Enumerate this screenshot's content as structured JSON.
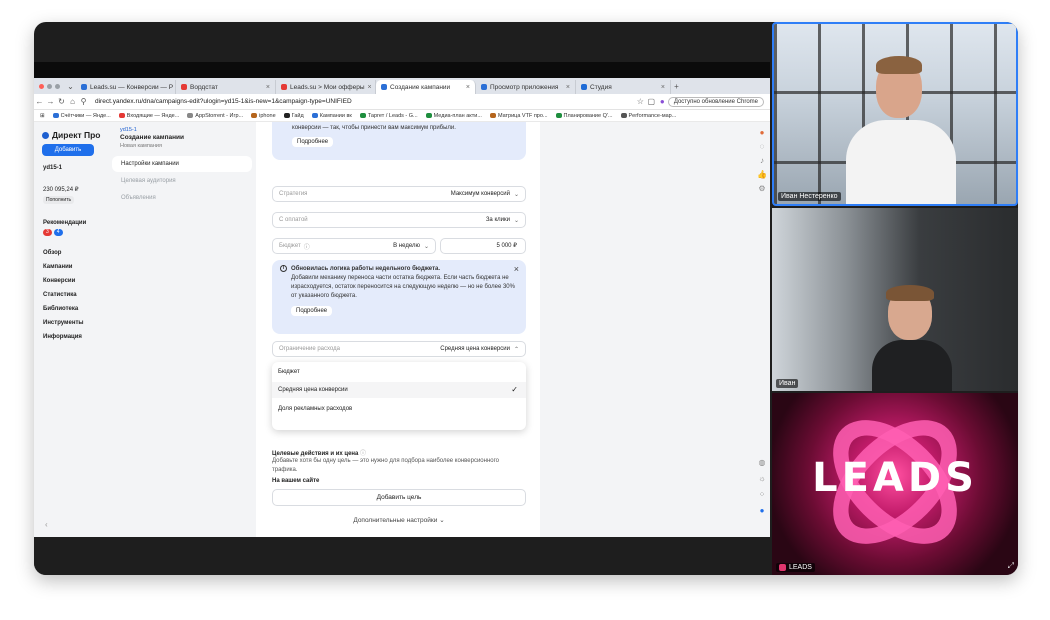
{
  "browser": {
    "tabs": [
      {
        "label": "Leads.su — Конверсии — Р",
        "color": "#2b6fd6",
        "active": false
      },
      {
        "label": "Вордстат",
        "color": "#e53935",
        "active": false
      },
      {
        "label": "Leads.su > Мои офферы",
        "color": "#e53935",
        "active": false
      },
      {
        "label": "Создание кампании",
        "color": "#2b6fd6",
        "active": true
      },
      {
        "label": "Просмотр приложения",
        "color": "#2b6fd6",
        "active": false
      },
      {
        "label": "Студия",
        "color": "#1e6bd6",
        "active": false
      }
    ],
    "url": "direct.yandex.ru/dna/campaigns-edit?ulogin=yd15-1&is-new=1&campaign-type=UNIFIED",
    "update_button": "Доступно обновление Chrome",
    "bookmarks": [
      "Счётчики — Янде...",
      "Входящие — Янде...",
      "AppStorrent - Игр...",
      "iphone",
      "Гайд",
      "Кампании вк",
      "Таргет / Leads - G...",
      "Медиа-план акти...",
      "Матрица VTF про...",
      "Планирование Q'...",
      "Performance-мар..."
    ]
  },
  "sidebar": {
    "logo": "Директ Про",
    "add_button": "Добавить",
    "account": "yd15-1",
    "balance": "230 095,24 ₽",
    "pay_button": "Пополнить",
    "recommendations": "Рекомендации",
    "badges": [
      "3",
      "4"
    ],
    "items": [
      "Обзор",
      "Кампании",
      "Конверсии",
      "Статистика",
      "Библиотека",
      "Инструменты",
      "Информация"
    ],
    "collapse": "‹"
  },
  "steps": {
    "account": "yd15-1",
    "title": "Создание кампании",
    "subtitle": "Новая кампания",
    "items": [
      {
        "label": "Настройки кампании",
        "state": "active"
      },
      {
        "label": "Целевая аудитория",
        "state": "muted"
      },
      {
        "label": "Объявления",
        "state": "muted"
      }
    ]
  },
  "form": {
    "top_info_text": "конверсии — так, чтобы принести вам максимум прибыли.",
    "more_label": "Подробнее",
    "strategy": {
      "label": "Стратегия",
      "value": "Максимум конверсий"
    },
    "payment": {
      "label": "С оплатой",
      "value": "За клики"
    },
    "budget": {
      "label": "Бюджет",
      "period": "В неделю",
      "amount": "5 000 ₽"
    },
    "notice": {
      "title": "Обновилась логика работы недельного бюджета.",
      "text": "Добавили механику переноса части остатка бюджета. Если часть бюджета не израсходуется, остаток переносится на следующую неделю — но не более 30% от указанного бюджета.",
      "button": "Подробнее"
    },
    "spend_limit": {
      "label": "Ограничение расхода",
      "value": "Средняя цена конверсии"
    },
    "dropdown_options": [
      "Бюджет",
      "Средняя цена конверсии",
      "Доля рекламных расходов"
    ],
    "selected_option": "Средняя цена конверсии",
    "goals_title": "Целевые действия и их цена",
    "goals_desc": "Добавьте хотя бы одну цель — это нужно для подбора наиболее конверсионного трафика.",
    "on_site": "На вашем сайте",
    "add_goal": "Добавить цель",
    "extra_settings": "Дополнительные настройки"
  },
  "participants": [
    {
      "name": "Иван Нестеренко",
      "active_speaker": true
    },
    {
      "name": "Иван",
      "active_speaker": false
    },
    {
      "name": "LEADS",
      "active_speaker": false,
      "logo_text": "LEADS"
    }
  ],
  "colors": {
    "accent": "#1f6feb",
    "info_bg": "#e4ebfb",
    "speaker_border": "#2f7ef7",
    "leads_pink": "#ff4fa0"
  }
}
